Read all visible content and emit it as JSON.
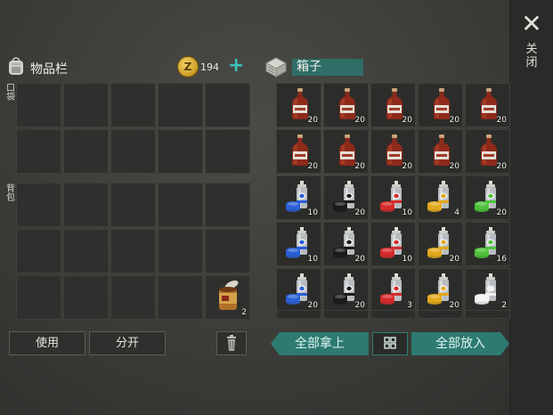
{
  "close": {
    "icon": "close-icon",
    "label": "关闭"
  },
  "inventory": {
    "title": "物品栏",
    "coin_icon": "coin-icon",
    "coin_symbol": "Z",
    "coins": "194",
    "add_icon": "plus-icon",
    "pocket_label": "口袋",
    "backpack_label": "背包",
    "pocket_slots": [
      "",
      "",
      "",
      "",
      "",
      "",
      "",
      "",
      "",
      ""
    ],
    "backpack_slots": [
      {
        "item": "",
        "count": ""
      },
      {
        "item": "",
        "count": ""
      },
      {
        "item": "",
        "count": ""
      },
      {
        "item": "",
        "count": ""
      },
      {
        "item": "",
        "count": ""
      },
      {
        "item": "",
        "count": ""
      },
      {
        "item": "",
        "count": ""
      },
      {
        "item": "",
        "count": ""
      },
      {
        "item": "",
        "count": ""
      },
      {
        "item": "",
        "count": ""
      },
      {
        "item": "",
        "count": ""
      },
      {
        "item": "",
        "count": ""
      },
      {
        "item": "",
        "count": ""
      },
      {
        "item": "",
        "count": ""
      },
      {
        "item": "canned-food",
        "count": "2"
      }
    ]
  },
  "container": {
    "title": "箱子",
    "icon": "box-icon",
    "slots": [
      {
        "item": "bottle",
        "count": "20"
      },
      {
        "item": "bottle",
        "count": "20"
      },
      {
        "item": "bottle",
        "count": "20"
      },
      {
        "item": "bottle",
        "count": "20"
      },
      {
        "item": "bottle",
        "count": "20"
      },
      {
        "item": "bottle",
        "count": "20"
      },
      {
        "item": "bottle",
        "count": "20"
      },
      {
        "item": "bottle",
        "count": "20"
      },
      {
        "item": "bottle",
        "count": "20"
      },
      {
        "item": "bottle",
        "count": "20"
      },
      {
        "item": "spray",
        "cap": "#2a5fd6",
        "count": "10"
      },
      {
        "item": "spray",
        "cap": "#1a1a1a",
        "count": "20"
      },
      {
        "item": "spray",
        "cap": "#d62a2a",
        "count": "10"
      },
      {
        "item": "spray",
        "cap": "#e3a81c",
        "count": "4"
      },
      {
        "item": "spray",
        "cap": "#4fc23a",
        "count": "20"
      },
      {
        "item": "spray",
        "cap": "#2a5fd6",
        "count": "10"
      },
      {
        "item": "spray",
        "cap": "#1a1a1a",
        "count": "20"
      },
      {
        "item": "spray",
        "cap": "#d62a2a",
        "count": "10"
      },
      {
        "item": "spray",
        "cap": "#e3a81c",
        "count": "20"
      },
      {
        "item": "spray",
        "cap": "#4fc23a",
        "count": "16"
      },
      {
        "item": "spray",
        "cap": "#2a5fd6",
        "count": "20"
      },
      {
        "item": "spray",
        "cap": "#1a1a1a",
        "count": "20"
      },
      {
        "item": "spray",
        "cap": "#d62a2a",
        "count": "3"
      },
      {
        "item": "spray",
        "cap": "#e3a81c",
        "count": "20"
      },
      {
        "item": "spray",
        "cap": "#f2f2f2",
        "count": "2"
      }
    ]
  },
  "buttons": {
    "use": "使用",
    "split": "分开",
    "trash_icon": "trash-icon",
    "take_all": "全部拿上",
    "sort_icon": "sort-grid-icon",
    "put_all": "全部放入"
  },
  "colors": {
    "accent": "#2d7a70",
    "teal_text": "#38c2b5",
    "coin": "#d9a92a"
  }
}
